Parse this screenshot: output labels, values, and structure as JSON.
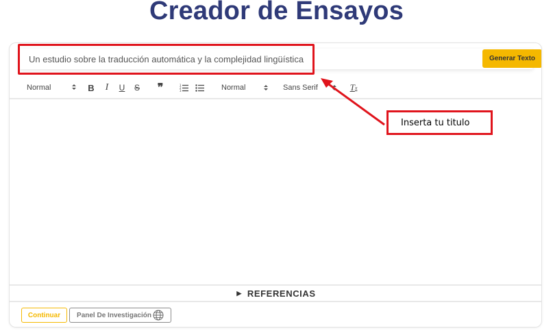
{
  "page": {
    "title": "Creador de Ensayos"
  },
  "title_input": {
    "value": "Un estudio sobre la traducción automática y la complejidad lingüística"
  },
  "generate_button": {
    "label": "Generar Texto"
  },
  "toolbar": {
    "header_select": "Normal",
    "size_select": "Normal",
    "font_select": "Sans Serif",
    "icons": [
      "bold-icon",
      "italic-icon",
      "underline-icon",
      "strikethrough-icon",
      "blockquote-icon",
      "ordered-list-icon",
      "bullet-list-icon",
      "clear-format-icon"
    ]
  },
  "references": {
    "label": "REFERENCIAS"
  },
  "continue_button": {
    "label": "Continuar"
  },
  "research_panel_button": {
    "label": "Panel De Investigación"
  },
  "annotation": {
    "callout_text": "Inserta tu titulo"
  },
  "colors": {
    "title": "#2f3a78",
    "accent": "#f5b800",
    "annotation_red": "#e0141c"
  }
}
